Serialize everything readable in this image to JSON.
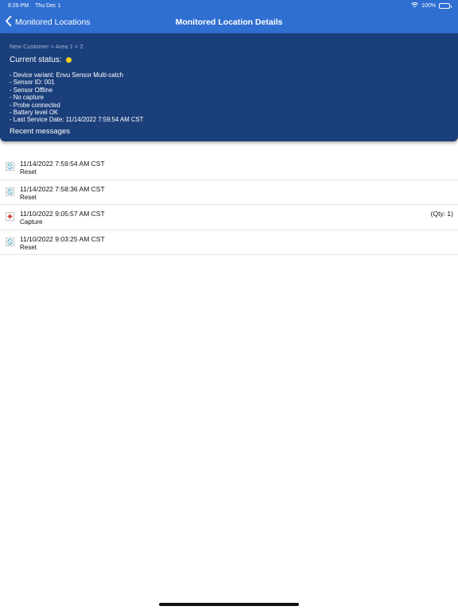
{
  "status_bar": {
    "time": "8:29 PM",
    "date": "Thu Dec 1",
    "battery": "100%",
    "battery_level": 1.0
  },
  "nav": {
    "back_label": "Monitored Locations",
    "title": "Monitored Location Details"
  },
  "details": {
    "breadcrumb": "New Customer > Area 1 > 2",
    "status_label": "Current status:",
    "status_color": "#f5cf1c",
    "lines": [
      "- Device variant: Envu Sensor Multi-catch",
      "- Sensor ID: 001",
      "- Sensor Offline",
      "- No capture",
      "- Probe connected",
      "- Battery level OK",
      "- Last Service Date:  11/14/2022 7:59:54 AM CST"
    ],
    "recent_label": "Recent messages"
  },
  "messages": [
    {
      "time": "11/14/2022 7:59:54 AM CST",
      "type": "Reset",
      "qty": "",
      "icon": "reset-icon"
    },
    {
      "time": "11/14/2022 7:58:36 AM CST",
      "type": "Reset",
      "qty": "",
      "icon": "reset-icon"
    },
    {
      "time": "11/10/2022 9:05:57 AM CST",
      "type": "Capture",
      "qty": "(Qty: 1)",
      "icon": "capture-icon"
    },
    {
      "time": "11/10/2022 9:03:25 AM CST",
      "type": "Reset",
      "qty": "",
      "icon": "reset-icon"
    }
  ],
  "colors": {
    "nav_blue": "#2f6fd2",
    "card_navy": "#1b3f7b",
    "reset_icon": "#3fa6c8",
    "capture_icon": "#d93a3a"
  }
}
